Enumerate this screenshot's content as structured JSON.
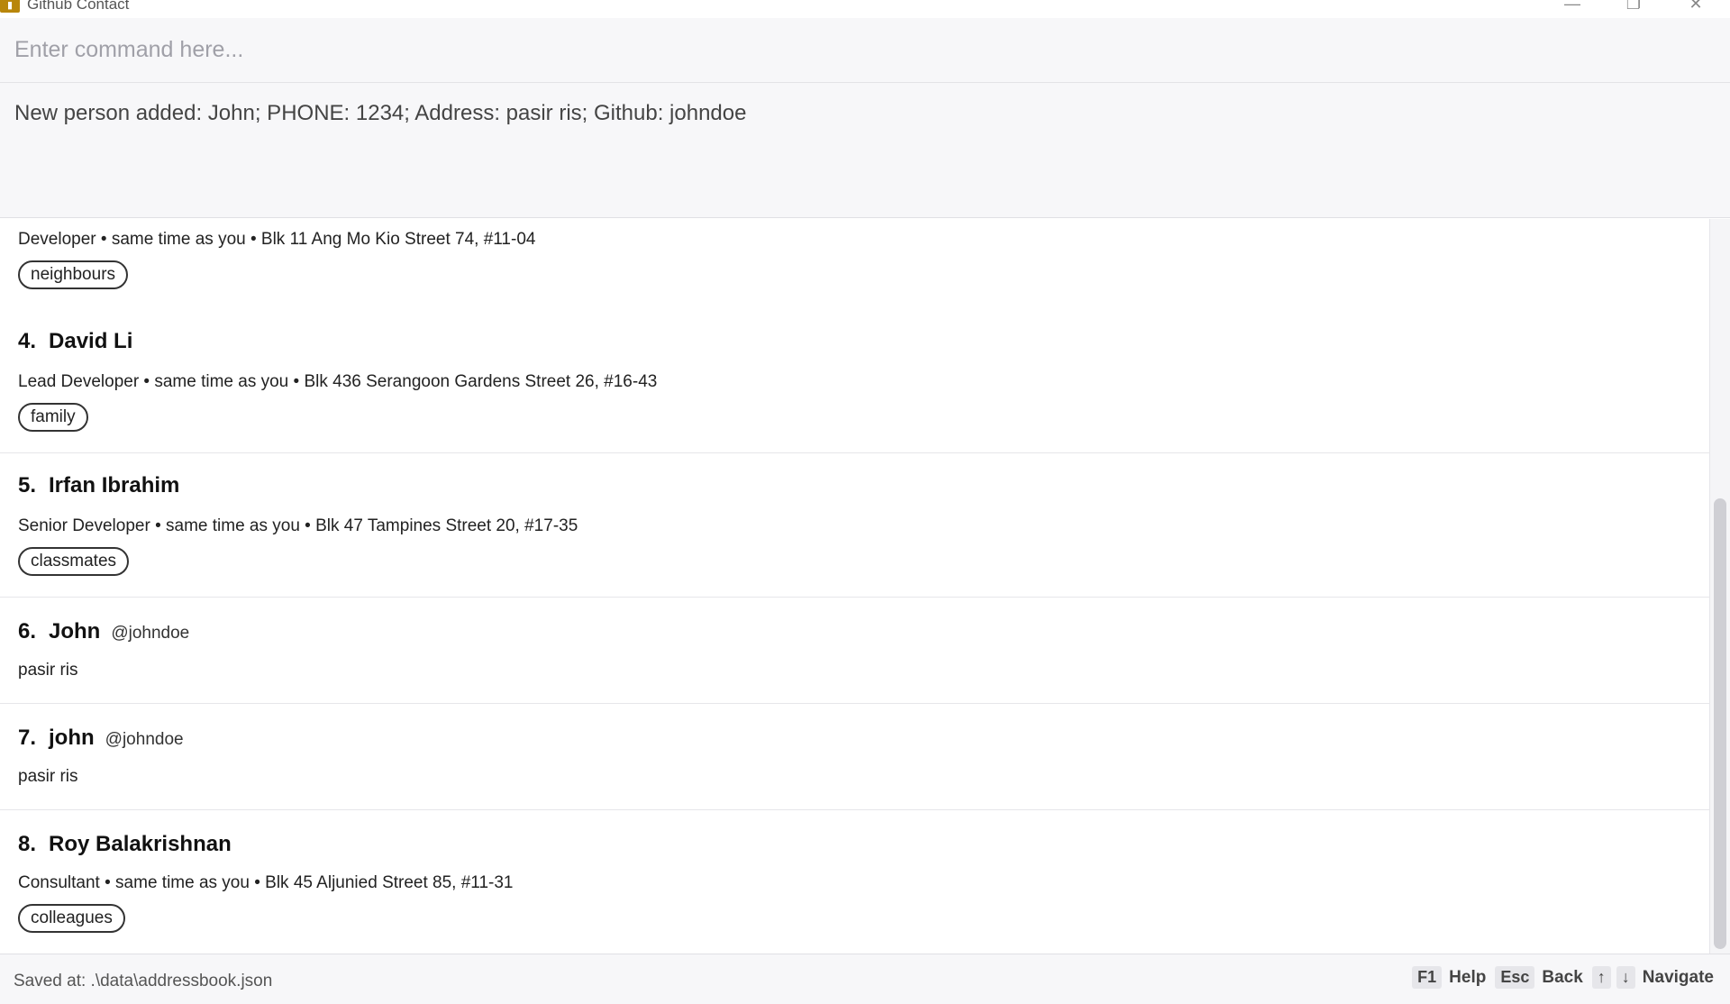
{
  "window": {
    "title": "Github Contact",
    "min_glyph": "—",
    "max_glyph": "❐",
    "close_glyph": "✕"
  },
  "command": {
    "placeholder": "Enter command here...",
    "value": ""
  },
  "result": {
    "message": "New person added: John; PHONE: 1234; Address: pasir ris; Github: johndoe"
  },
  "persons": [
    {
      "index": "",
      "name": "",
      "github": "",
      "details": "Developer • same time as you • Blk 11 Ang Mo Kio Street 74, #11-04",
      "tag": "neighbours"
    },
    {
      "index": "4.",
      "name": "David Li",
      "github": "",
      "details": "Lead Developer • same time as you • Blk 436 Serangoon Gardens Street 26, #16-43",
      "tag": "family"
    },
    {
      "index": "5.",
      "name": "Irfan Ibrahim",
      "github": "",
      "details": "Senior Developer • same time as you • Blk 47 Tampines Street 20, #17-35",
      "tag": "classmates"
    },
    {
      "index": "6.",
      "name": "John",
      "github": "@johndoe",
      "details": "pasir ris",
      "tag": ""
    },
    {
      "index": "7.",
      "name": "john",
      "github": "@johndoe",
      "details": "pasir ris",
      "tag": ""
    },
    {
      "index": "8.",
      "name": "Roy Balakrishnan",
      "github": "",
      "details": "Consultant • same time as you • Blk 45 Aljunied Street 85, #11-31",
      "tag": "colleagues"
    }
  ],
  "status": {
    "saved_path": "Saved at: .\\data\\addressbook.json",
    "hints": [
      {
        "key": "F1",
        "label": "Help"
      },
      {
        "key": "Esc",
        "label": "Back"
      },
      {
        "key": "↑",
        "label": ""
      },
      {
        "key": "↓",
        "label": "Navigate"
      }
    ]
  },
  "icons": {
    "app": "app-icon",
    "minimize": "minimize-icon",
    "maximize": "maximize-icon",
    "close": "close-icon"
  }
}
